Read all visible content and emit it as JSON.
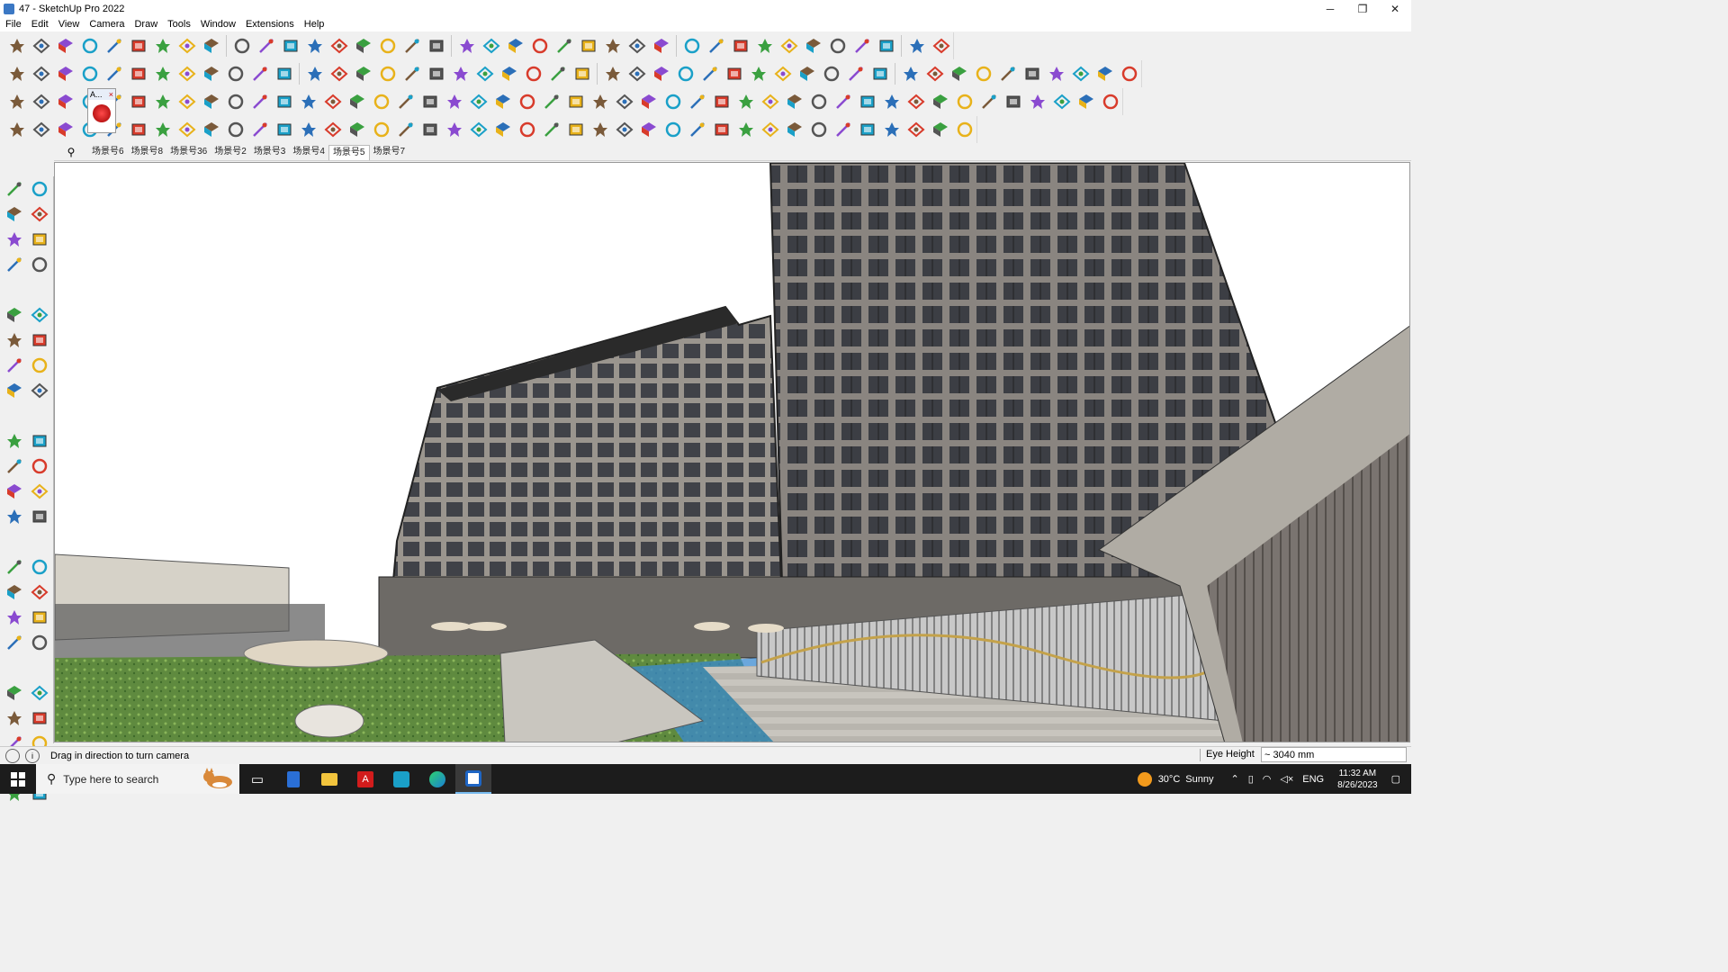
{
  "window": {
    "title": "47 - SketchUp Pro 2022",
    "minimize": "─",
    "maximize": "❐",
    "close": "✕"
  },
  "menu": [
    "File",
    "Edit",
    "View",
    "Camera",
    "Draw",
    "Tools",
    "Window",
    "Extensions",
    "Help"
  ],
  "scenes": {
    "search_icon": "⚲",
    "tabs": [
      "场景号6",
      "场景号8",
      "场景号36",
      "场景号2",
      "场景号3",
      "场景号4",
      "场景号5",
      "场景号7"
    ],
    "active": "场景号5"
  },
  "popup_label": "A...",
  "status": {
    "info_icon": "i",
    "message": "Drag in direction to turn camera"
  },
  "vcb": {
    "label": "Eye Height",
    "value": "~ 3040 mm"
  },
  "taskbar": {
    "search_placeholder": "Type here to search",
    "weather_temp": "30°C",
    "weather_desc": "Sunny",
    "lang": "ENG",
    "time": "11:32 AM",
    "date": "8/26/2023",
    "apps": [
      "task-view",
      "calculator",
      "file-explorer",
      "acrobat",
      "sketchup-3d",
      "edge",
      "sketchup"
    ]
  },
  "colors": {
    "accent": "#2b6fb8",
    "red": "#d83b2b",
    "green": "#3aa040",
    "yellow": "#e8b21a"
  }
}
